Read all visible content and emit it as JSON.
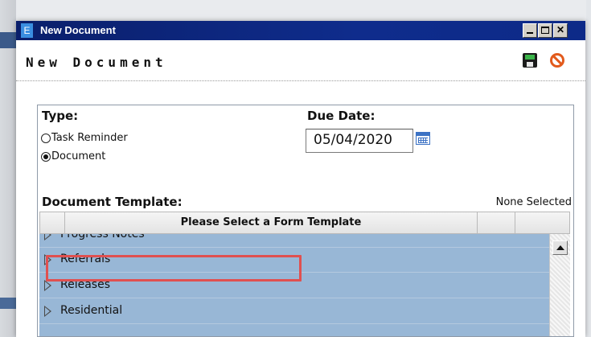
{
  "window": {
    "app_icon_letter": "E",
    "title": "New Document"
  },
  "header": {
    "heading": "New Document"
  },
  "form": {
    "type_label": "Type:",
    "type_options": [
      {
        "label": "Task Reminder",
        "selected": false
      },
      {
        "label": "Document",
        "selected": true
      }
    ],
    "due_date_label": "Due Date:",
    "due_date_value": "05/04/2020",
    "template_label": "Document Template:",
    "template_status": "None Selected"
  },
  "grid": {
    "column_header": "Please Select a Form Template",
    "rows": [
      {
        "label": "Progress Notes"
      },
      {
        "label": "Referrals"
      },
      {
        "label": "Releases"
      },
      {
        "label": "Residential"
      }
    ]
  },
  "icons": {
    "save": "save-floppy-icon",
    "cancel": "cancel-icon",
    "calendar": "calendar-icon"
  },
  "colors": {
    "titlebar": "#0f2c8c",
    "row_background": "#98b7d6",
    "highlight": "#e05050"
  }
}
